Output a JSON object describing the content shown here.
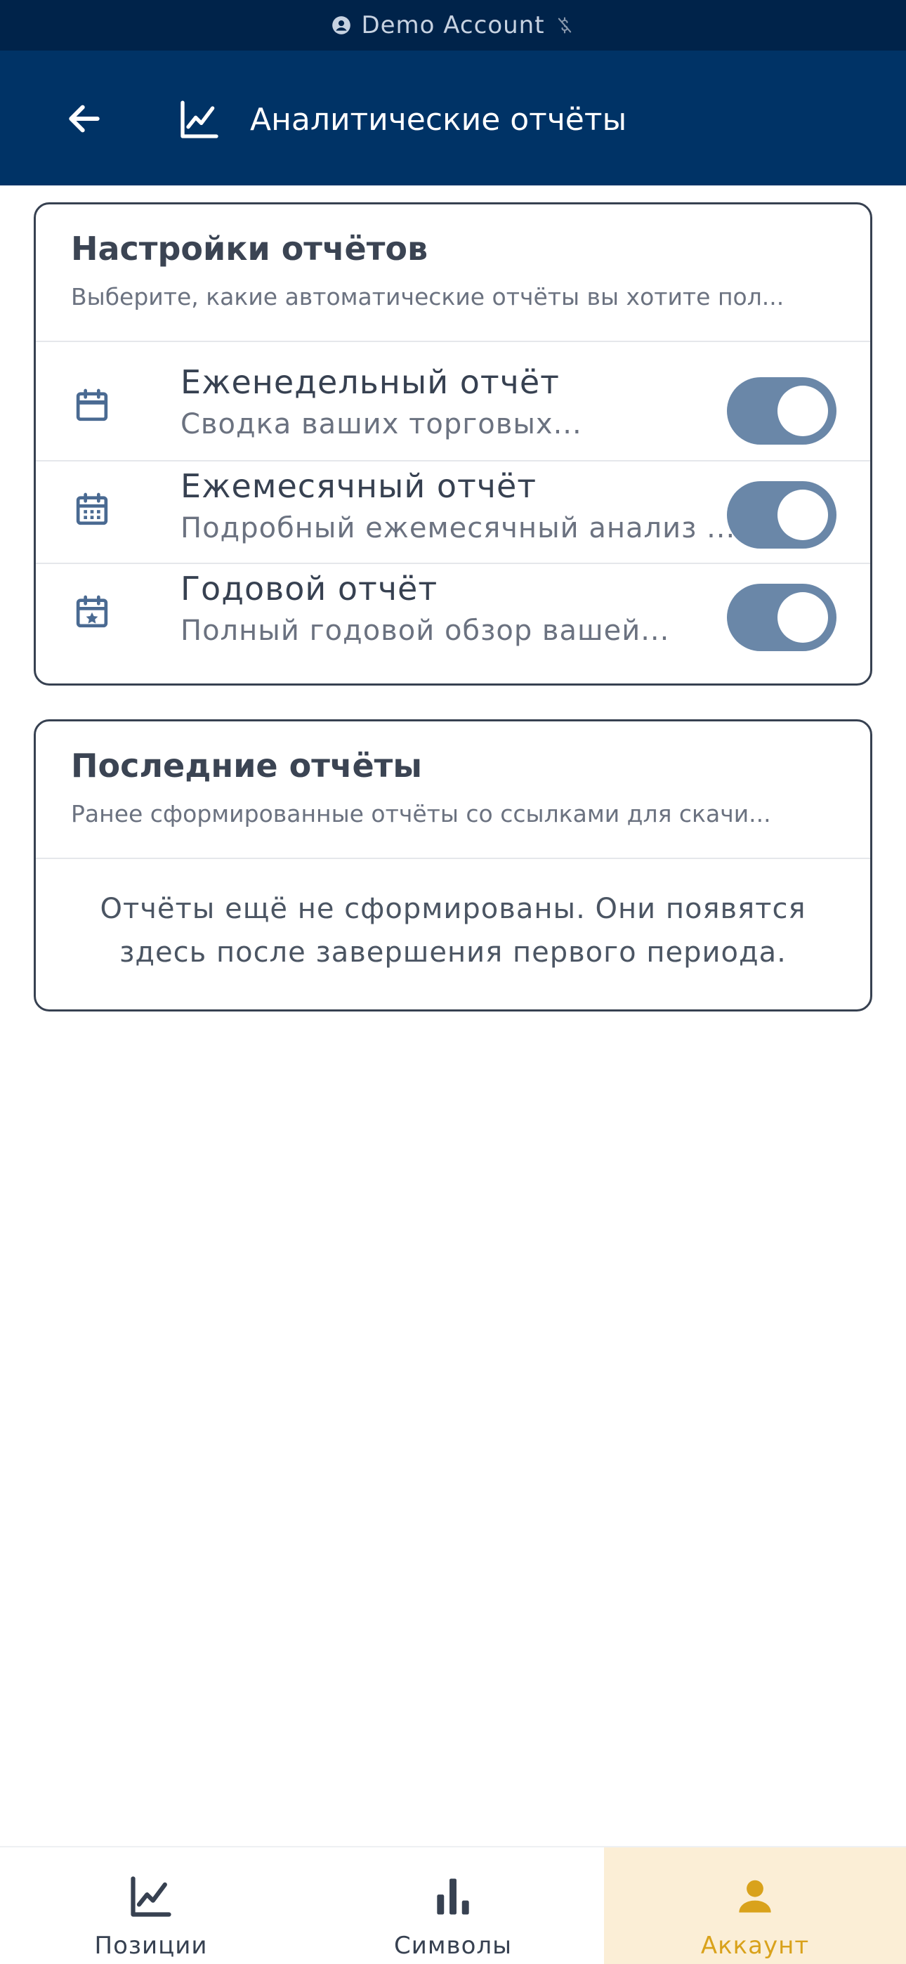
{
  "demo_banner": {
    "text": "Demo Account"
  },
  "header": {
    "title": "Аналитические отчёты"
  },
  "settings_card": {
    "title": "Настройки отчётов",
    "subtitle": "Выберите, какие автоматические отчёты вы хотите пол...",
    "reports": [
      {
        "title": "Еженедельный отчёт",
        "description": "Сводка ваших торговых...",
        "enabled": true
      },
      {
        "title": "Ежемесячный отчёт",
        "description": "Подробный ежемесячный анализ ...",
        "enabled": true
      },
      {
        "title": "Годовой отчёт",
        "description": "Полный годовой обзор вашей...",
        "enabled": true
      }
    ]
  },
  "recent_card": {
    "title": "Последние отчёты",
    "subtitle": "Ранее сформированные отчёты со ссылками для скачи...",
    "empty_line1": "Отчёты ещё не сформированы. Они появятся",
    "empty_line2": "здесь после завершения первого периода."
  },
  "bottom_nav": {
    "items": [
      {
        "label": "Позиции",
        "active": false
      },
      {
        "label": "Символы",
        "active": false
      },
      {
        "label": "Аккаунт",
        "active": true
      }
    ]
  },
  "colors": {
    "banner": "#00234a",
    "header": "#003366",
    "toggle_on": "#6a87a8",
    "icon": "#4a6a92",
    "nav_active_bg": "#fbeed6",
    "nav_active_fg": "#d9a21b"
  }
}
